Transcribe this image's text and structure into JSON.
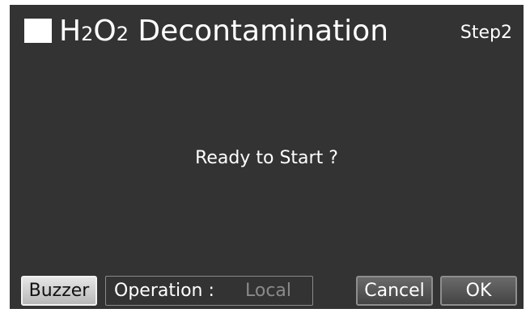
{
  "header": {
    "title_h": "H",
    "title_2a": "2",
    "title_o": "O",
    "title_2b": "2",
    "title_rest": " Decontamination",
    "step": "Step2"
  },
  "main": {
    "message": "Ready to Start ?"
  },
  "footer": {
    "buzzer_label": "Buzzer",
    "operation_label": "Operation :",
    "operation_value": "Local",
    "cancel_label": "Cancel",
    "ok_label": "OK"
  },
  "colors": {
    "background": "#333333",
    "text": "#ffffff",
    "disabled_text": "#8a8a8a"
  },
  "icons": {
    "title_marker": "square-marker-icon"
  }
}
